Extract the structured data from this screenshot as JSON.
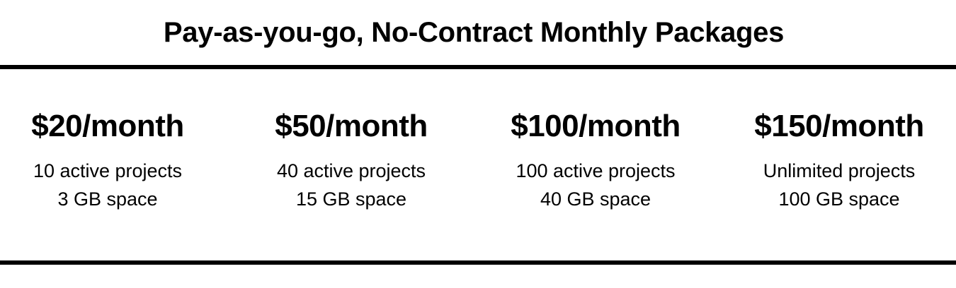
{
  "header": {
    "title": "Pay-as-you-go, No-Contract Monthly Packages"
  },
  "plans": [
    {
      "price": "$20/month",
      "projects": "10 active projects",
      "space": "3 GB space"
    },
    {
      "price": "$50/month",
      "projects": "40 active projects",
      "space": "15 GB space"
    },
    {
      "price": "$100/month",
      "projects": "100 active projects",
      "space": "40 GB space"
    },
    {
      "price": "$150/month",
      "projects": "Unlimited projects",
      "space": "100 GB space"
    }
  ],
  "colors": {
    "text": "#000000",
    "background": "#ffffff",
    "rule": "#000000"
  }
}
